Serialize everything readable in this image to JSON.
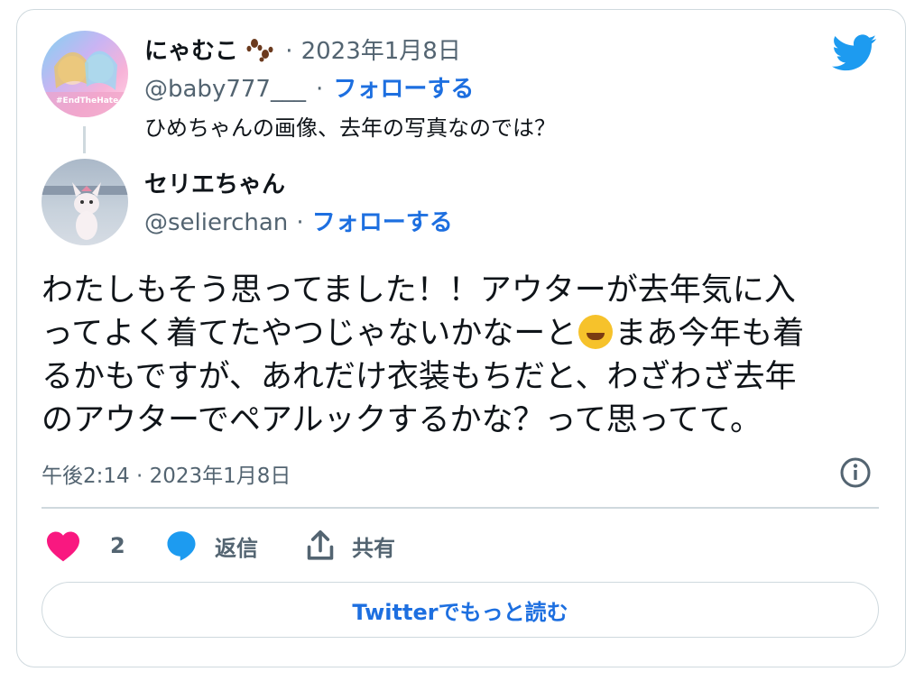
{
  "reply_tweet": {
    "name": "にゃむこ",
    "name_emoji": "paw-prints-icon",
    "dot": "·",
    "date": "2023年1月8日",
    "handle": "@baby777___",
    "follow_label": "フォローする",
    "text": "ひめちゃんの画像、去年の写真なのでは？",
    "avatar_caption": "#EndTheHate"
  },
  "main_tweet": {
    "name": "セリエちゃん",
    "handle": "@selierchan",
    "dot": "·",
    "follow_label": "フォローする",
    "lines": [
      "わたしもそう思ってました！！アウターが去年気に入",
      "ってよく着てたやつじゃないかなーと",
      "まあ今年も着",
      "るかもですが、あれだけ衣装もちだと、わざわざ去年",
      "のアウターでペアルックするかな？って思ってて。"
    ],
    "emoji": "rolling-on-floor-laughing",
    "timestamp": "午後2:14 · 2023年1月8日"
  },
  "actions": {
    "like_count": "2",
    "reply_label": "返信",
    "share_label": "共有"
  },
  "more_button": "Twitterでもっと読む",
  "colors": {
    "accent": "#1d9bf0",
    "like": "#f91880",
    "text_secondary": "#536471",
    "border": "#cfd9de"
  }
}
